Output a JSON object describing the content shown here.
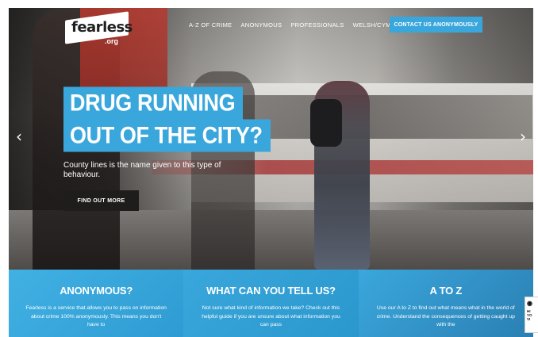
{
  "header": {
    "logo_text": "fearless",
    "logo_sub": ".org",
    "nav": [
      "A-Z OF CRIME",
      "ANONYMOUS",
      "PROFESSIONALS",
      "WELSH/CYMRAEG"
    ],
    "contact_label": "CONTACT US ANONYMOUSLY"
  },
  "hero": {
    "headline_line1": "DRUG RUNNING",
    "headline_line2": "OUT OF THE CITY?",
    "subtitle": "County lines is the name given to this type of behaviour.",
    "cta_label": "FIND OUT MORE",
    "prev_symbol": "‹",
    "next_symbol": "›"
  },
  "cards": [
    {
      "title": "ANONYMOUS?",
      "text": "Fearless is a service that allows you to pass on information about crime 100% anonymously. This means you don't have to"
    },
    {
      "title": "WHAT CAN YOU TELL US?",
      "text": "Not sure what kind of information we take? Check out this helpful guide if you are unsure about what information you can pass"
    },
    {
      "title": "A TO Z",
      "text": "Use our A to Z to find out what means what in the world of crime. Understand the consequences of getting caught up with the"
    }
  ],
  "widget": {
    "icon": "eye-icon",
    "text": "HI YO VI"
  },
  "colors": {
    "accent": "#3aa7dc",
    "dark_button": "#1f1d1c"
  }
}
